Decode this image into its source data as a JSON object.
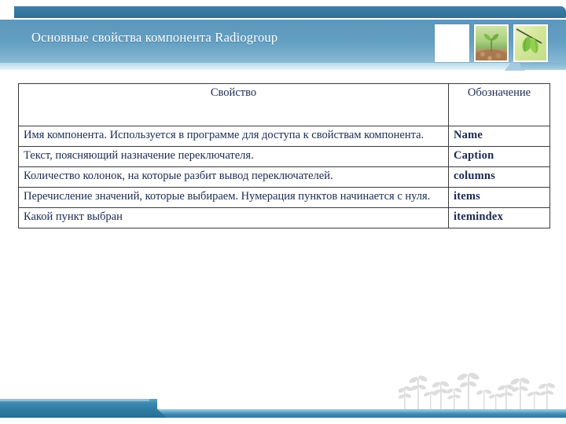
{
  "header": {
    "title": "Основные свойства компонента Radiogroup",
    "accent_color": "#2f7ba4",
    "band_color": "#5e9bbf",
    "underline_color": "#cfe8f3",
    "thumbnails": [
      {
        "name": "blank-thumbnail",
        "alt": "blank white image"
      },
      {
        "name": "sprout-thumbnail",
        "alt": "seedling sprouting from soil"
      },
      {
        "name": "leaves-thumbnail",
        "alt": "green leaves on a branch"
      }
    ]
  },
  "table": {
    "columns": [
      "Свойство",
      "Обозначение"
    ],
    "rows": [
      {
        "description": "Имя компонента. Используется в программе для доступа к свойствам компонента.",
        "code": "Name"
      },
      {
        "description": "Текст, поясняющий назначение переключателя.",
        "code": "Caption"
      },
      {
        "description": "Количество колонок, на которые разбит вывод переключателей.",
        "code": "columns"
      },
      {
        "description": "Перечисление значений, которые выбираем. Нумерация пунктов начинается с нуля.",
        "code": "items"
      },
      {
        "description": "Какой пункт выбран",
        "code": "itemindex"
      }
    ],
    "text_color": "#1b2a52",
    "border_color": "#3b3b3b"
  },
  "footer": {
    "bar_color": "#2f7ba4",
    "decoration": "grass-sprouts-silhouette",
    "decoration_color": "#dcdcdc"
  }
}
